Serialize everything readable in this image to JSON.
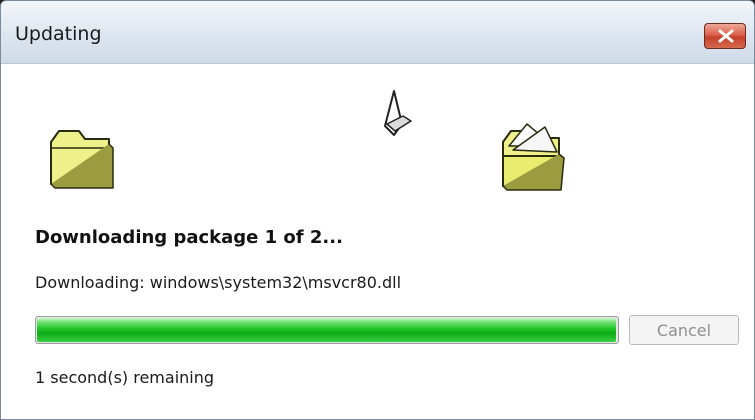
{
  "window": {
    "title": "Updating"
  },
  "animation": {
    "source_folder_icon": "folder-icon",
    "document_icon": "flying-document-icon",
    "target_folder_icon": "open-folder-icon"
  },
  "status": {
    "heading": "Downloading package 1 of 2...",
    "current_file": "Downloading: windows\\system32\\msvcr80.dll",
    "time_remaining": "1 second(s) remaining"
  },
  "progress": {
    "fraction": 0.998,
    "color": "#22c62a"
  },
  "buttons": {
    "cancel_label": "Cancel",
    "close_color": "#d9614a"
  }
}
